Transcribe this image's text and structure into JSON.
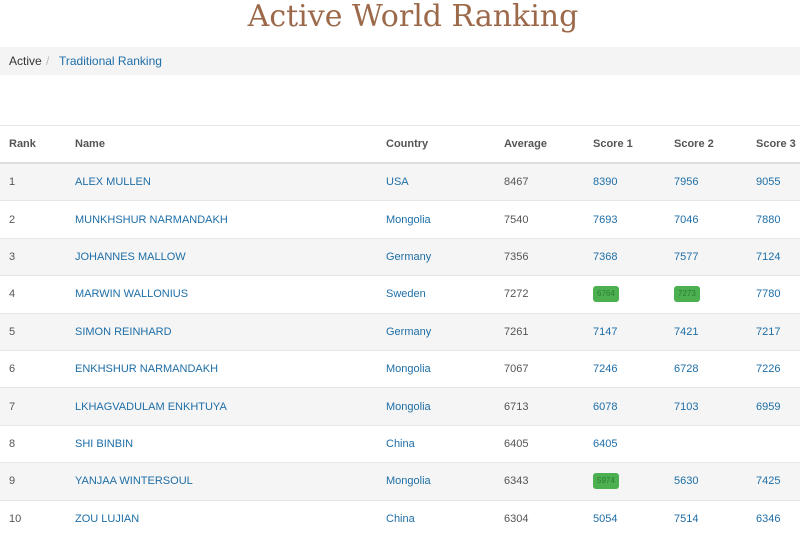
{
  "page": {
    "title": "Active World Ranking"
  },
  "breadcrumb": {
    "active": "Active",
    "separator": "/",
    "link": "Traditional Ranking"
  },
  "table": {
    "headers": [
      "Rank",
      "Name",
      "Country",
      "Average",
      "Score 1",
      "Score 2",
      "Score 3"
    ],
    "rows": [
      {
        "rank": "1",
        "name": "ALEX MULLEN",
        "country": "USA",
        "average": "8467",
        "s1": "8390",
        "s2": "7956",
        "s3": "9055"
      },
      {
        "rank": "2",
        "name": "MUNKHSHUR NARMANDAKH",
        "country": "Mongolia",
        "average": "7540",
        "s1": "7693",
        "s2": "7046",
        "s3": "7880"
      },
      {
        "rank": "3",
        "name": "JOHANNES MALLOW",
        "country": "Germany",
        "average": "7356",
        "s1": "7368",
        "s2": "7577",
        "s3": "7124"
      },
      {
        "rank": "4",
        "name": "MARWIN WALLONIUS",
        "country": "Sweden",
        "average": "7272",
        "s1": "6764",
        "s2": "7273",
        "s3": "7780"
      },
      {
        "rank": "5",
        "name": "SIMON REINHARD",
        "country": "Germany",
        "average": "7261",
        "s1": "7147",
        "s2": "7421",
        "s3": "7217"
      },
      {
        "rank": "6",
        "name": "ENKHSHUR NARMANDAKH",
        "country": "Mongolia",
        "average": "7067",
        "s1": "7246",
        "s2": "6728",
        "s3": "7226"
      },
      {
        "rank": "7",
        "name": "LKHAGVADULAM ENKHTUYA",
        "country": "Mongolia",
        "average": "6713",
        "s1": "6078",
        "s2": "7103",
        "s3": "6959"
      },
      {
        "rank": "8",
        "name": "SHI BINBIN",
        "country": "China",
        "average": "6405",
        "s1": "6405",
        "s2": "",
        "s3": ""
      },
      {
        "rank": "9",
        "name": "YANJAA WINTERSOUL",
        "country": "Mongolia",
        "average": "6343",
        "s1": "5974",
        "s2": "5630",
        "s3": "7425"
      },
      {
        "rank": "10",
        "name": "ZOU LUJIAN",
        "country": "China",
        "average": "6304",
        "s1": "5054",
        "s2": "7514",
        "s3": "6346"
      }
    ]
  },
  "badges": {
    "color": "#4caf50"
  }
}
